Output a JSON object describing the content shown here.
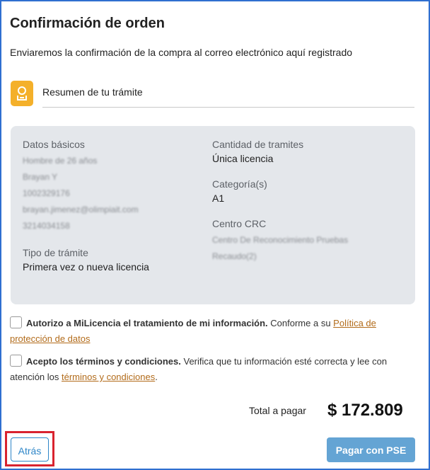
{
  "header": {
    "title": "Confirmación de orden",
    "subtitle": "Enviaremos la confirmación de la compra al correo electrónico aquí registrado"
  },
  "summary": {
    "icon": "certificate-icon",
    "label": "Resumen de tu trámite"
  },
  "card": {
    "datos_basicos": {
      "label": "Datos básicos",
      "lines": [
        "Hombre de 26 años",
        "Brayan Y",
        "1002329176",
        "brayan.jimenez@olimpiait.com",
        "3214034158"
      ]
    },
    "tipo_tramite": {
      "label": "Tipo de trámite",
      "value": "Primera vez o nueva licencia"
    },
    "cantidad": {
      "label": "Cantidad de tramites",
      "value": "Única licencia"
    },
    "categoria": {
      "label": "Categoría(s)",
      "value": "A1"
    },
    "centro": {
      "label": "Centro CRC",
      "lines": [
        "Centro De Reconocimiento Pruebas",
        "Recaudo(2)"
      ]
    }
  },
  "consents": {
    "privacy": {
      "bold": "Autorizo a MiLicencia el tratamiento de mi información.",
      "text": " Conforme a su ",
      "link": "Política de protección de datos"
    },
    "terms": {
      "bold": "Acepto los términos y condiciones.",
      "text": " Verifica que tu información esté correcta y lee con atención los ",
      "link": "términos y condiciones",
      "end": "."
    }
  },
  "total": {
    "label": "Total a pagar",
    "amount": "$ 172.809"
  },
  "actions": {
    "back_label": "Atrás",
    "pay_label": "Pagar con PSE"
  },
  "colors": {
    "accent": "#2e86c8",
    "pay_button": "#64a4d4",
    "icon_bg": "#f4b02a",
    "highlight": "#d9232f",
    "link": "#b26b1a"
  }
}
